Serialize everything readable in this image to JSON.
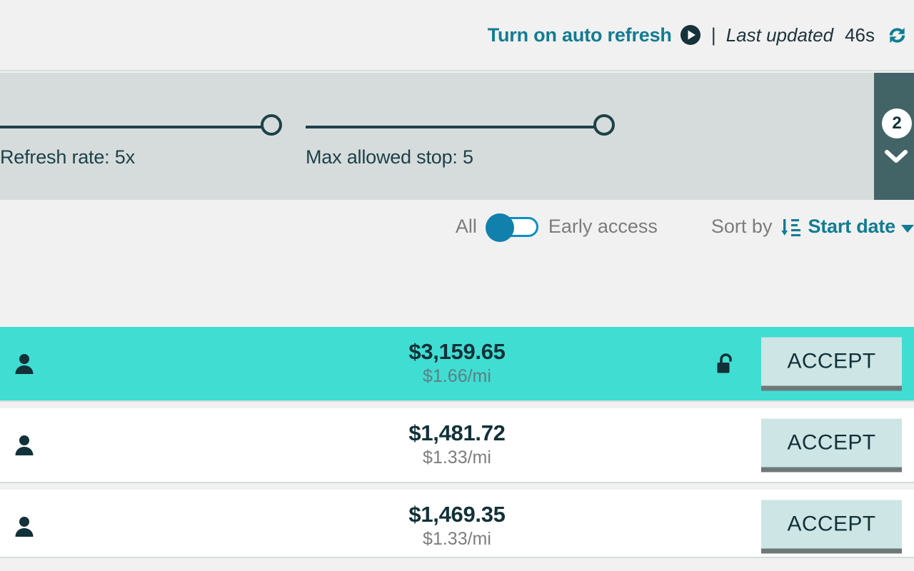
{
  "header": {
    "auto_refresh_label": "Turn on auto refresh",
    "play_icon": "play-circle-icon",
    "divider": "|",
    "last_updated_label": "Last updated",
    "last_updated_value": "46s",
    "refresh_icon": "refresh-cycle-icon"
  },
  "sliders": {
    "refresh_rate": {
      "caption": "Refresh rate: 5x",
      "value": 5,
      "name": "refresh-rate-slider"
    },
    "max_stop": {
      "caption": "Max allowed stop: 5",
      "value": 5,
      "name": "max-allowed-stop-slider"
    }
  },
  "collapse_rail": {
    "badge_count": "2",
    "chevron_icon": "chevron-down-icon"
  },
  "filters": {
    "toggle_left_label": "All",
    "toggle_right_label": "Early access",
    "toggle_state": "All",
    "sort_by_label": "Sort by",
    "sort_icon": "sort-ascending-icon",
    "sort_value": "Start date",
    "caret_icon": "caret-down-icon"
  },
  "loads": [
    {
      "person_icon": "person-icon",
      "total": "$3,159.65",
      "per_mile": "$1.66/mi",
      "lock_icon": "unlock-icon",
      "has_lock": true,
      "accept_label": "ACCEPT",
      "highlighted": true
    },
    {
      "person_icon": "person-icon",
      "total": "$1,481.72",
      "per_mile": "$1.33/mi",
      "lock_icon": "",
      "has_lock": false,
      "accept_label": "ACCEPT",
      "highlighted": false
    },
    {
      "person_icon": "person-icon",
      "total": "$1,469.35",
      "per_mile": "$1.33/mi",
      "lock_icon": "",
      "has_lock": false,
      "accept_label": "ACCEPT",
      "highlighted": false
    }
  ],
  "colors": {
    "teal_accent": "#127C92",
    "highlight_row": "#40DDD2",
    "panel_grey": "#D6DCDC",
    "rail_dark": "#436466",
    "accept_bg": "#CDE5E5",
    "accept_underline": "#6F7878",
    "page_bg": "#F1F1F1",
    "toggle_blue": "#1180AC"
  }
}
